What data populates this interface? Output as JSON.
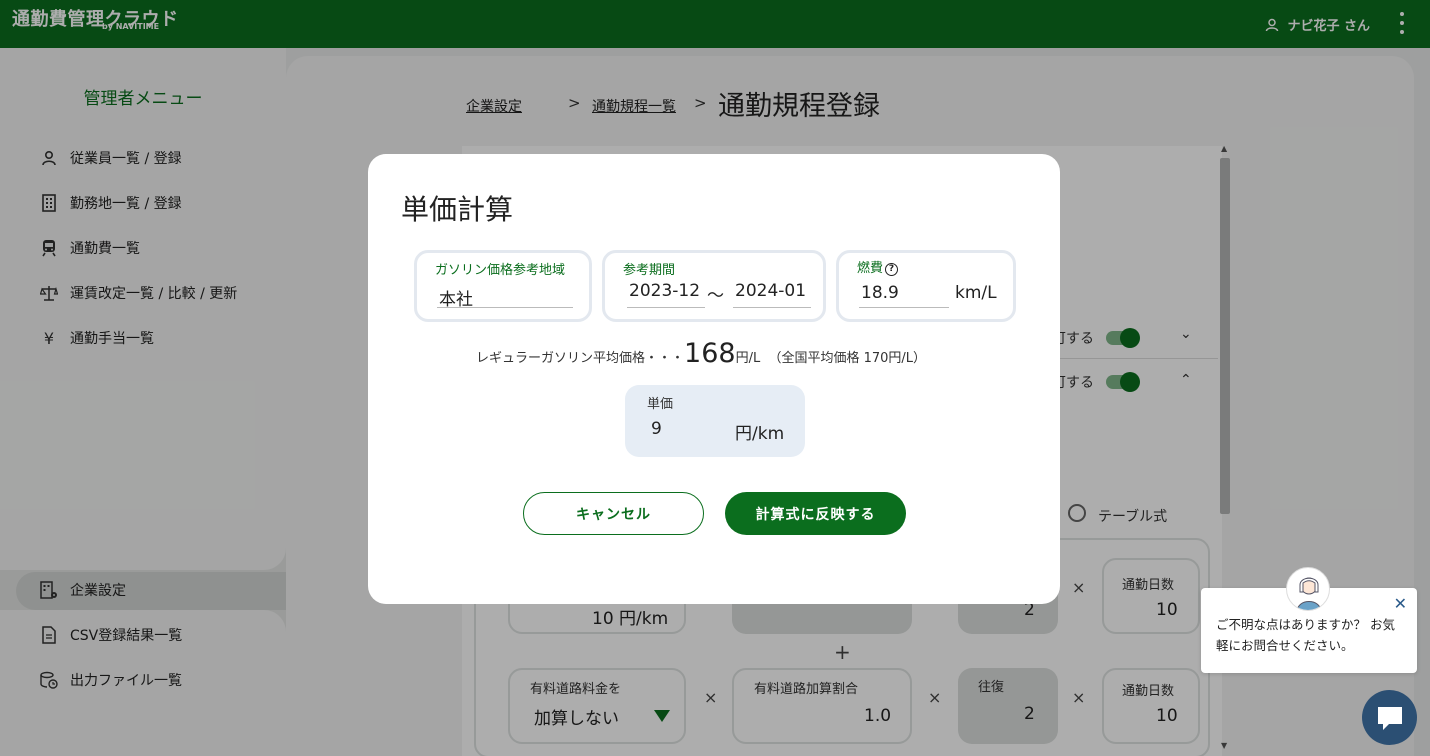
{
  "header": {
    "logo_title": "通勤費管理クラウド",
    "logo_sub": "by NAVITIME",
    "user_name": "ナビ花子 さん"
  },
  "sidebar": {
    "title": "管理者メニュー",
    "items": [
      {
        "label": "従業員一覧 / 登録",
        "icon": "person-icon"
      },
      {
        "label": "勤務地一覧 / 登録",
        "icon": "building-icon"
      },
      {
        "label": "通勤費一覧",
        "icon": "train-icon"
      },
      {
        "label": "運賃改定一覧 / 比較 / 更新",
        "icon": "scale-icon"
      },
      {
        "label": "通勤手当一覧",
        "icon": "yen-icon"
      }
    ],
    "bottom_items": [
      {
        "label": "企業設定",
        "icon": "company-settings-icon",
        "active": true
      },
      {
        "label": "CSV登録結果一覧",
        "icon": "document-icon"
      },
      {
        "label": "出力ファイル一覧",
        "icon": "file-history-icon"
      }
    ]
  },
  "breadcrumb": {
    "item1": "企業設定",
    "item2": "通勤規程一覧",
    "separator": ">",
    "current": "通勤規程登録"
  },
  "background_form": {
    "row1_text": "可する",
    "row2_text": "可する",
    "radio_label": "テーブル式",
    "plus": "+",
    "times": "×",
    "card1_value": "10 円/km",
    "card3_value": "2",
    "card4_label": "通勤日数",
    "card4_value": "10",
    "toll_label": "有料道路料金を",
    "toll_value": "加算しない",
    "toll_rate_label": "有料道路加算割合",
    "toll_rate_value": "1.0",
    "round_label": "往復",
    "round_value": "2",
    "days_label": "通勤日数",
    "days_value": "10"
  },
  "modal": {
    "title": "単価計算",
    "region_label": "ガソリン価格参考地域",
    "region_value": "本社",
    "period_label": "参考期間",
    "period_from": "2023-12",
    "period_sep": "〜",
    "period_to": "2024-01",
    "fuel_label": "燃費",
    "fuel_value": "18.9",
    "fuel_unit": "km/L",
    "price_prefix": "レギュラーガソリン平均価格・・・",
    "price_value": "168",
    "price_unit": "円/L",
    "price_national": "（全国平均価格 170円/L）",
    "unit_label": "単価",
    "unit_value": "9",
    "unit_unit": "円/km",
    "cancel_label": "キャンセル",
    "apply_label": "計算式に反映する"
  },
  "chat": {
    "message": "ご不明な点はありますか？ お気軽にお問合せください。"
  },
  "colors": {
    "brand_green": "#0b6e1e",
    "chat_blue": "#2b4f73"
  }
}
